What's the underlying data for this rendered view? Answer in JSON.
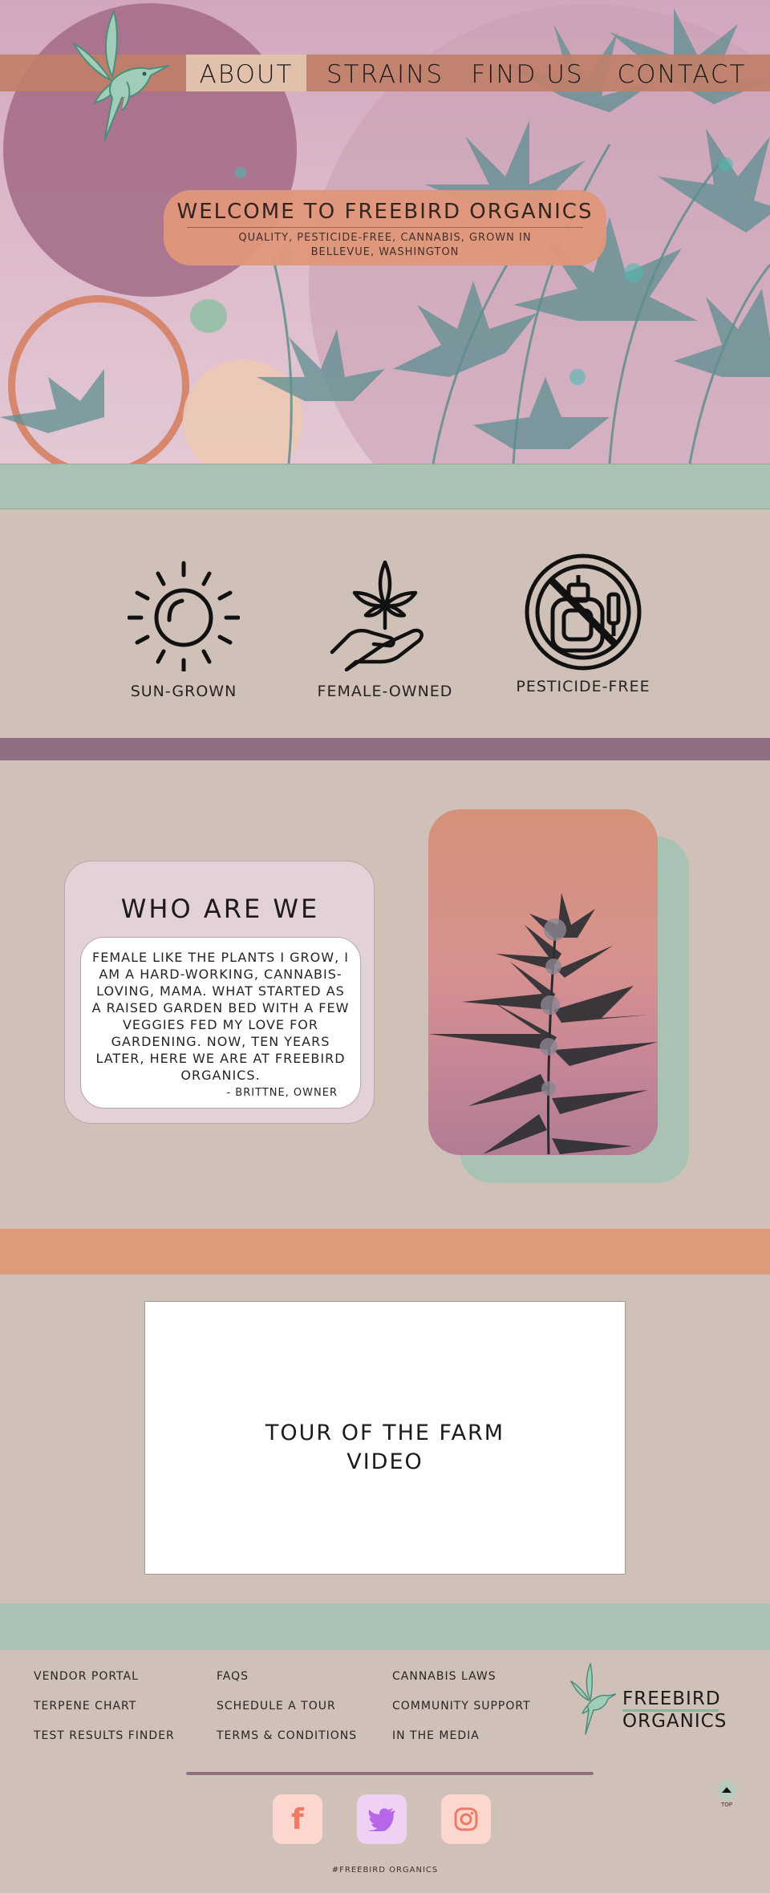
{
  "nav": {
    "items": [
      "ABOUT",
      "STRAINS",
      "FIND US",
      "CONTACT"
    ],
    "active": "ABOUT"
  },
  "hero": {
    "title": "WELCOME TO FREEBIRD ORGANICS",
    "subtitle": "QUALITY, PESTICIDE-FREE, CANNABIS, GROWN IN BELLEVUE, WASHINGTON"
  },
  "features": [
    {
      "label": "SUN-GROWN",
      "icon": "sun-icon"
    },
    {
      "label": "FEMALE-OWNED",
      "icon": "hand-leaf-icon"
    },
    {
      "label": "PESTICIDE-FREE",
      "icon": "no-pesticide-icon"
    }
  ],
  "about": {
    "title": "WHO ARE WE",
    "body": "FEMALE LIKE THE PLANTS I GROW, I AM A HARD-WORKING, CANNABIS-LOVING, MAMA. WHAT STARTED AS A RAISED GARDEN BED WITH A FEW VEGGIES FED MY LOVE FOR GARDENING. NOW, TEN YEARS LATER, HERE WE ARE AT FREEBIRD ORGANICS.",
    "signature": "- BRITTNE, OWNER"
  },
  "video": {
    "label": "TOUR OF THE FARM\nVIDEO"
  },
  "footer": {
    "col1": [
      "VENDOR PORTAL",
      "TERPENE CHART",
      "TEST RESULTS FINDER"
    ],
    "col2": [
      "FAQS",
      "SCHEDULE A TOUR",
      "TERMS & CONDITIONS"
    ],
    "col3": [
      "CANNABIS LAWS",
      "COMMUNITY SUPPORT",
      "IN THE MEDIA"
    ],
    "logo_line1": "FREEBIRD",
    "logo_line2": "ORGANICS",
    "hashtag": "#FREEBIRD ORGANICS",
    "top_label": "TOP",
    "social": [
      "facebook-icon",
      "twitter-icon",
      "instagram-icon"
    ]
  },
  "colors": {
    "green": "#a9c2b3",
    "purple": "#8f6f83",
    "orange": "#de9a79",
    "background": "#cfc1b8"
  }
}
